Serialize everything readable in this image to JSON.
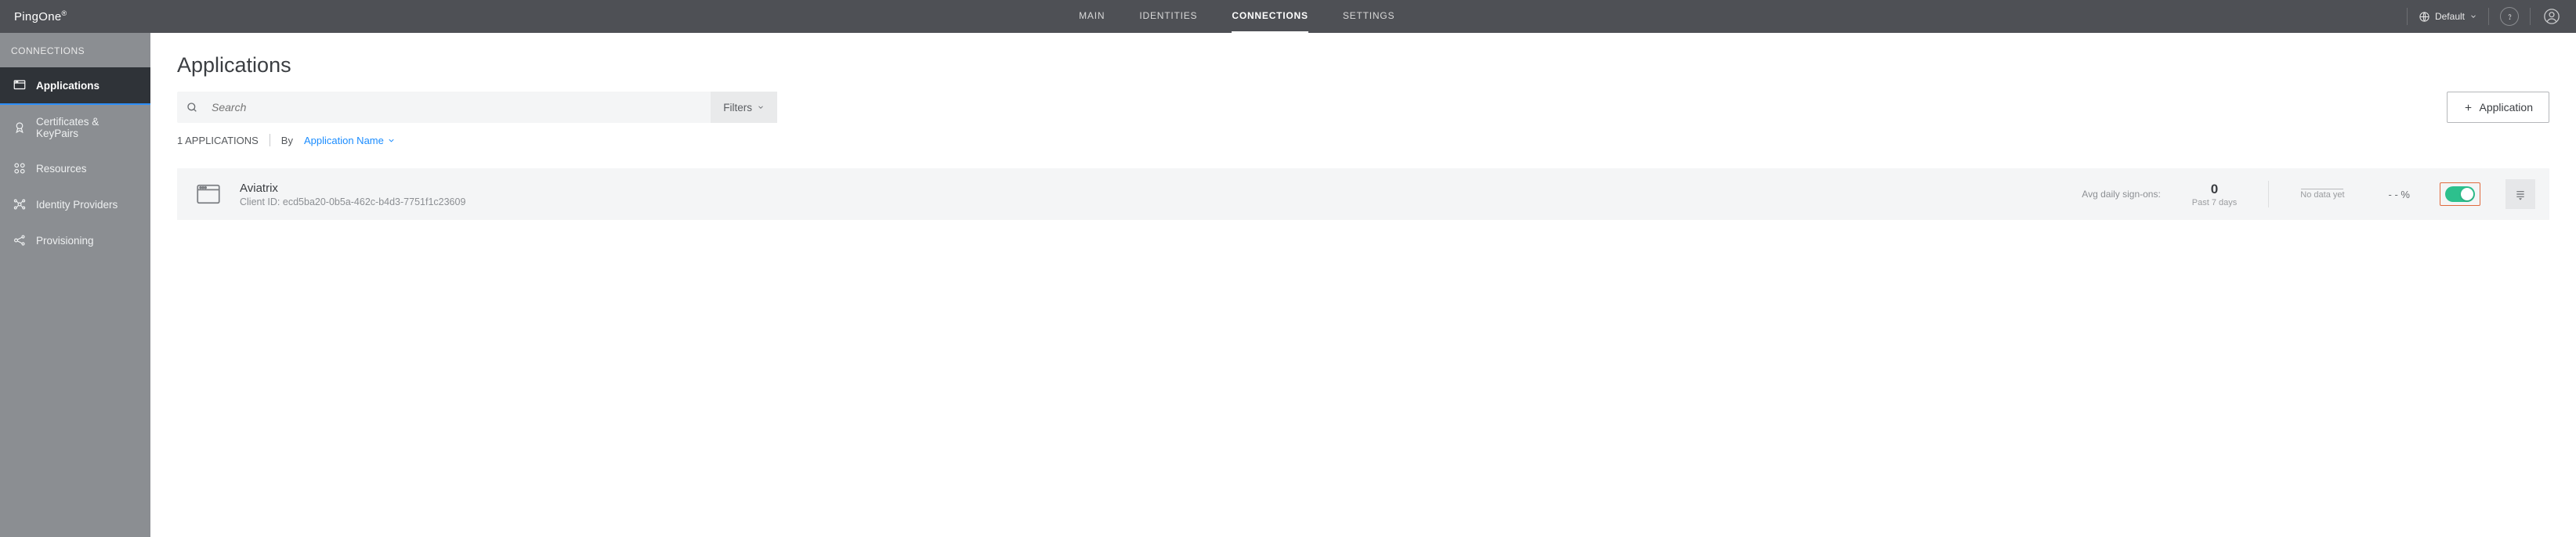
{
  "brand": "PingOne",
  "topnav": {
    "main": "MAIN",
    "identities": "IDENTITIES",
    "connections": "CONNECTIONS",
    "settings": "SETTINGS"
  },
  "environment": {
    "label": "Default"
  },
  "sidebar": {
    "title": "CONNECTIONS",
    "items": {
      "applications": "Applications",
      "certificates": "Certificates & KeyPairs",
      "resources": "Resources",
      "identity_providers": "Identity Providers",
      "provisioning": "Provisioning"
    }
  },
  "page": {
    "title": "Applications",
    "search_placeholder": "Search",
    "filters_label": "Filters",
    "add_app_label": "Application",
    "count_label": "1 APPLICATIONS",
    "sort_by_prefix": "By",
    "sort_by_value": "Application Name"
  },
  "apps": [
    {
      "name": "Aviatrix",
      "client_id_label": "Client ID:",
      "client_id": "ecd5ba20-0b5a-462c-b4d3-7751f1c23609",
      "metric_label": "Avg daily sign-ons:",
      "metric_value": "0",
      "metric_period": "Past 7 days",
      "spark_caption": "No data yet",
      "pct": "- - %",
      "enabled": true
    }
  ]
}
